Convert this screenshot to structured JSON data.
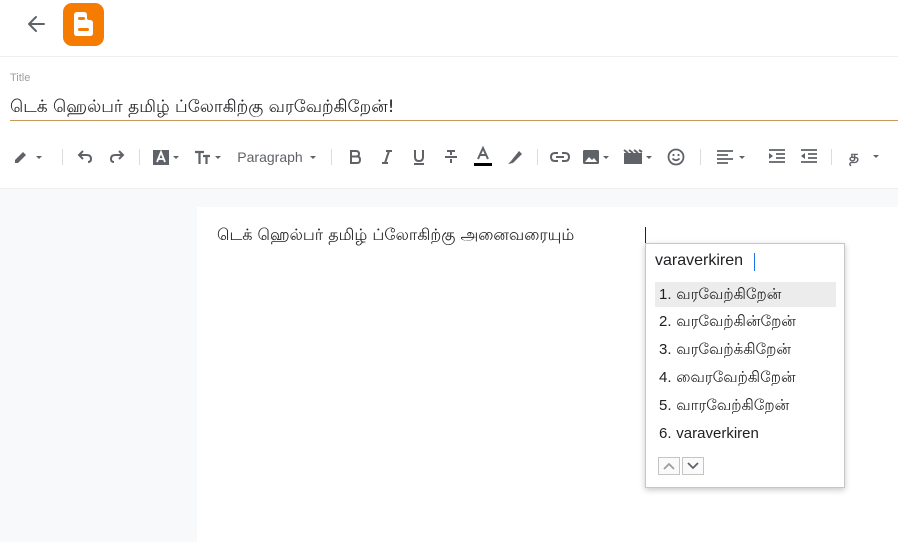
{
  "header": {
    "back_icon": "arrow-back-icon",
    "logo_icon": "blogger-logo",
    "logo_color": "#f57c00"
  },
  "title": {
    "label": "Title",
    "value": "டெக் ஹெல்பர் தமிழ் ப்லோகிற்கு வரவேற்கிறேன்!"
  },
  "toolbar": {
    "paragraph_label": "Paragraph",
    "icons": [
      "pencil-icon",
      "undo-icon",
      "redo-icon",
      "font-icon",
      "text-size-icon",
      "bold-icon",
      "italic-icon",
      "underline-icon",
      "strikethrough-icon",
      "text-color-icon",
      "highlight-icon",
      "link-icon",
      "image-icon",
      "video-icon",
      "emoji-icon",
      "align-icon",
      "indent-icon",
      "outdent-icon",
      "input-tools-icon"
    ],
    "text_color_swatch": "#000000",
    "input_tools_glyph": "த"
  },
  "editor": {
    "body_text": "டெக் ஹெல்பர் தமிழ் ப்லோகிற்கு அனைவரையும்"
  },
  "ime": {
    "input": "varaverkiren",
    "candidates": [
      {
        "num": "1.",
        "text": "வரவேற்கிறேன்"
      },
      {
        "num": "2.",
        "text": "வரவேற்கின்றேன்"
      },
      {
        "num": "3.",
        "text": "வரவேற்க்கிறேன்"
      },
      {
        "num": "4.",
        "text": "வைரவேற்கிறேன்"
      },
      {
        "num": "5.",
        "text": "வாரவேற்கிறேன்"
      },
      {
        "num": "6.",
        "text": "varaverkiren"
      }
    ],
    "selected_index": 0,
    "pager_icons": [
      "chevron-up-icon",
      "chevron-down-icon"
    ]
  }
}
